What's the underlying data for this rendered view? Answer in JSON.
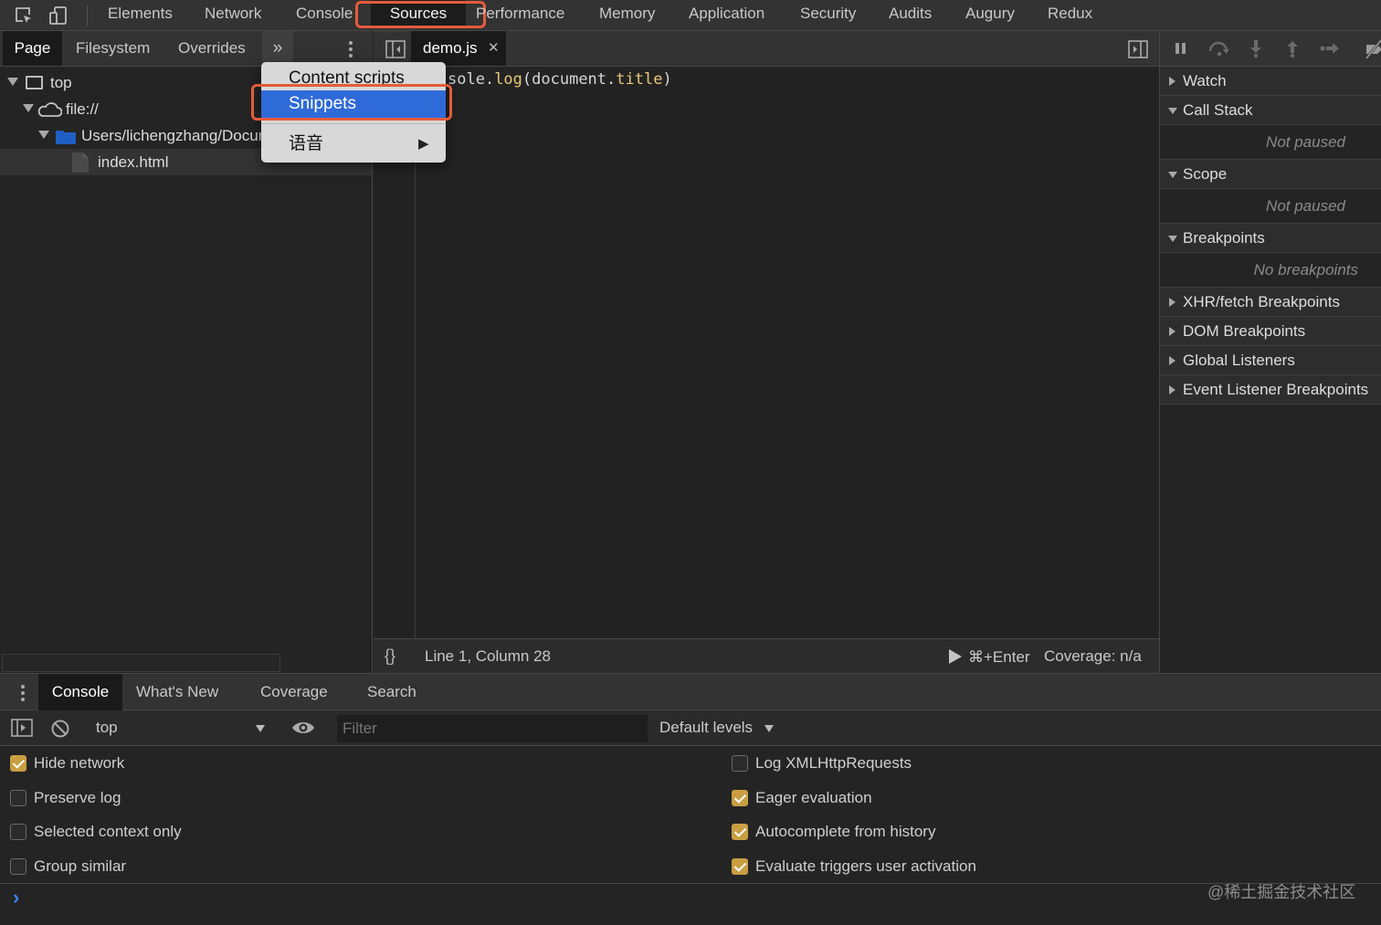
{
  "main_tabs": [
    "Elements",
    "Network",
    "Console",
    "Sources",
    "Performance",
    "Memory",
    "Application",
    "Security",
    "Audits",
    "Augury",
    "Redux"
  ],
  "active_main_tab": "Sources",
  "navigator": {
    "tabs": [
      "Page",
      "Filesystem",
      "Overrides"
    ],
    "more_tabs_glyph": "»",
    "tree": {
      "frame": "top",
      "origin": "file://",
      "folder": "Users/lichengzhang/Documents",
      "file": "index.html"
    }
  },
  "context_menu": {
    "items": [
      "Content scripts",
      "Snippets",
      "语音"
    ],
    "selected": "Snippets",
    "submenu_arrow": "▶"
  },
  "editor": {
    "tab": "demo.js",
    "code": {
      "visible_prefix": "sole.",
      "method": "log",
      "open": "(document.",
      "prop": "title",
      "close": ")"
    },
    "status": {
      "format_button": "{}",
      "position": "Line 1, Column 28",
      "run_shortcut": "⌘+Enter",
      "coverage": "Coverage: n/a"
    }
  },
  "debugger": {
    "sections": [
      {
        "title": "Watch",
        "expanded": false
      },
      {
        "title": "Call Stack",
        "expanded": true,
        "body": "Not paused"
      },
      {
        "title": "Scope",
        "expanded": true,
        "body": "Not paused"
      },
      {
        "title": "Breakpoints",
        "expanded": true,
        "body": "No breakpoints"
      },
      {
        "title": "XHR/fetch Breakpoints",
        "expanded": false
      },
      {
        "title": "DOM Breakpoints",
        "expanded": false
      },
      {
        "title": "Global Listeners",
        "expanded": false
      },
      {
        "title": "Event Listener Breakpoints",
        "expanded": false
      }
    ]
  },
  "drawer": {
    "tabs": [
      "Console",
      "What's New",
      "Coverage",
      "Search"
    ],
    "active_tab": "Console",
    "context": "top",
    "filter_placeholder": "Filter",
    "levels": "Default levels"
  },
  "console_settings": {
    "left": [
      {
        "label": "Hide network",
        "checked": true
      },
      {
        "label": "Preserve log",
        "checked": false
      },
      {
        "label": "Selected context only",
        "checked": false
      },
      {
        "label": "Group similar",
        "checked": false
      }
    ],
    "right": [
      {
        "label": "Log XMLHttpRequests",
        "checked": false
      },
      {
        "label": "Eager evaluation",
        "checked": true
      },
      {
        "label": "Autocomplete from history",
        "checked": true
      },
      {
        "label": "Evaluate triggers user activation",
        "checked": true
      }
    ]
  },
  "prompt_glyph": "›",
  "watermark": "@稀土掘金技术社区",
  "colors": {
    "highlight_box": "#e55b3c",
    "menu_selected": "#2f6ad9",
    "checkbox_on": "#c99e41",
    "code_method": "#e8c77a",
    "code_prop": "#e8c77a",
    "folder_icon": "#1f5fc4"
  }
}
